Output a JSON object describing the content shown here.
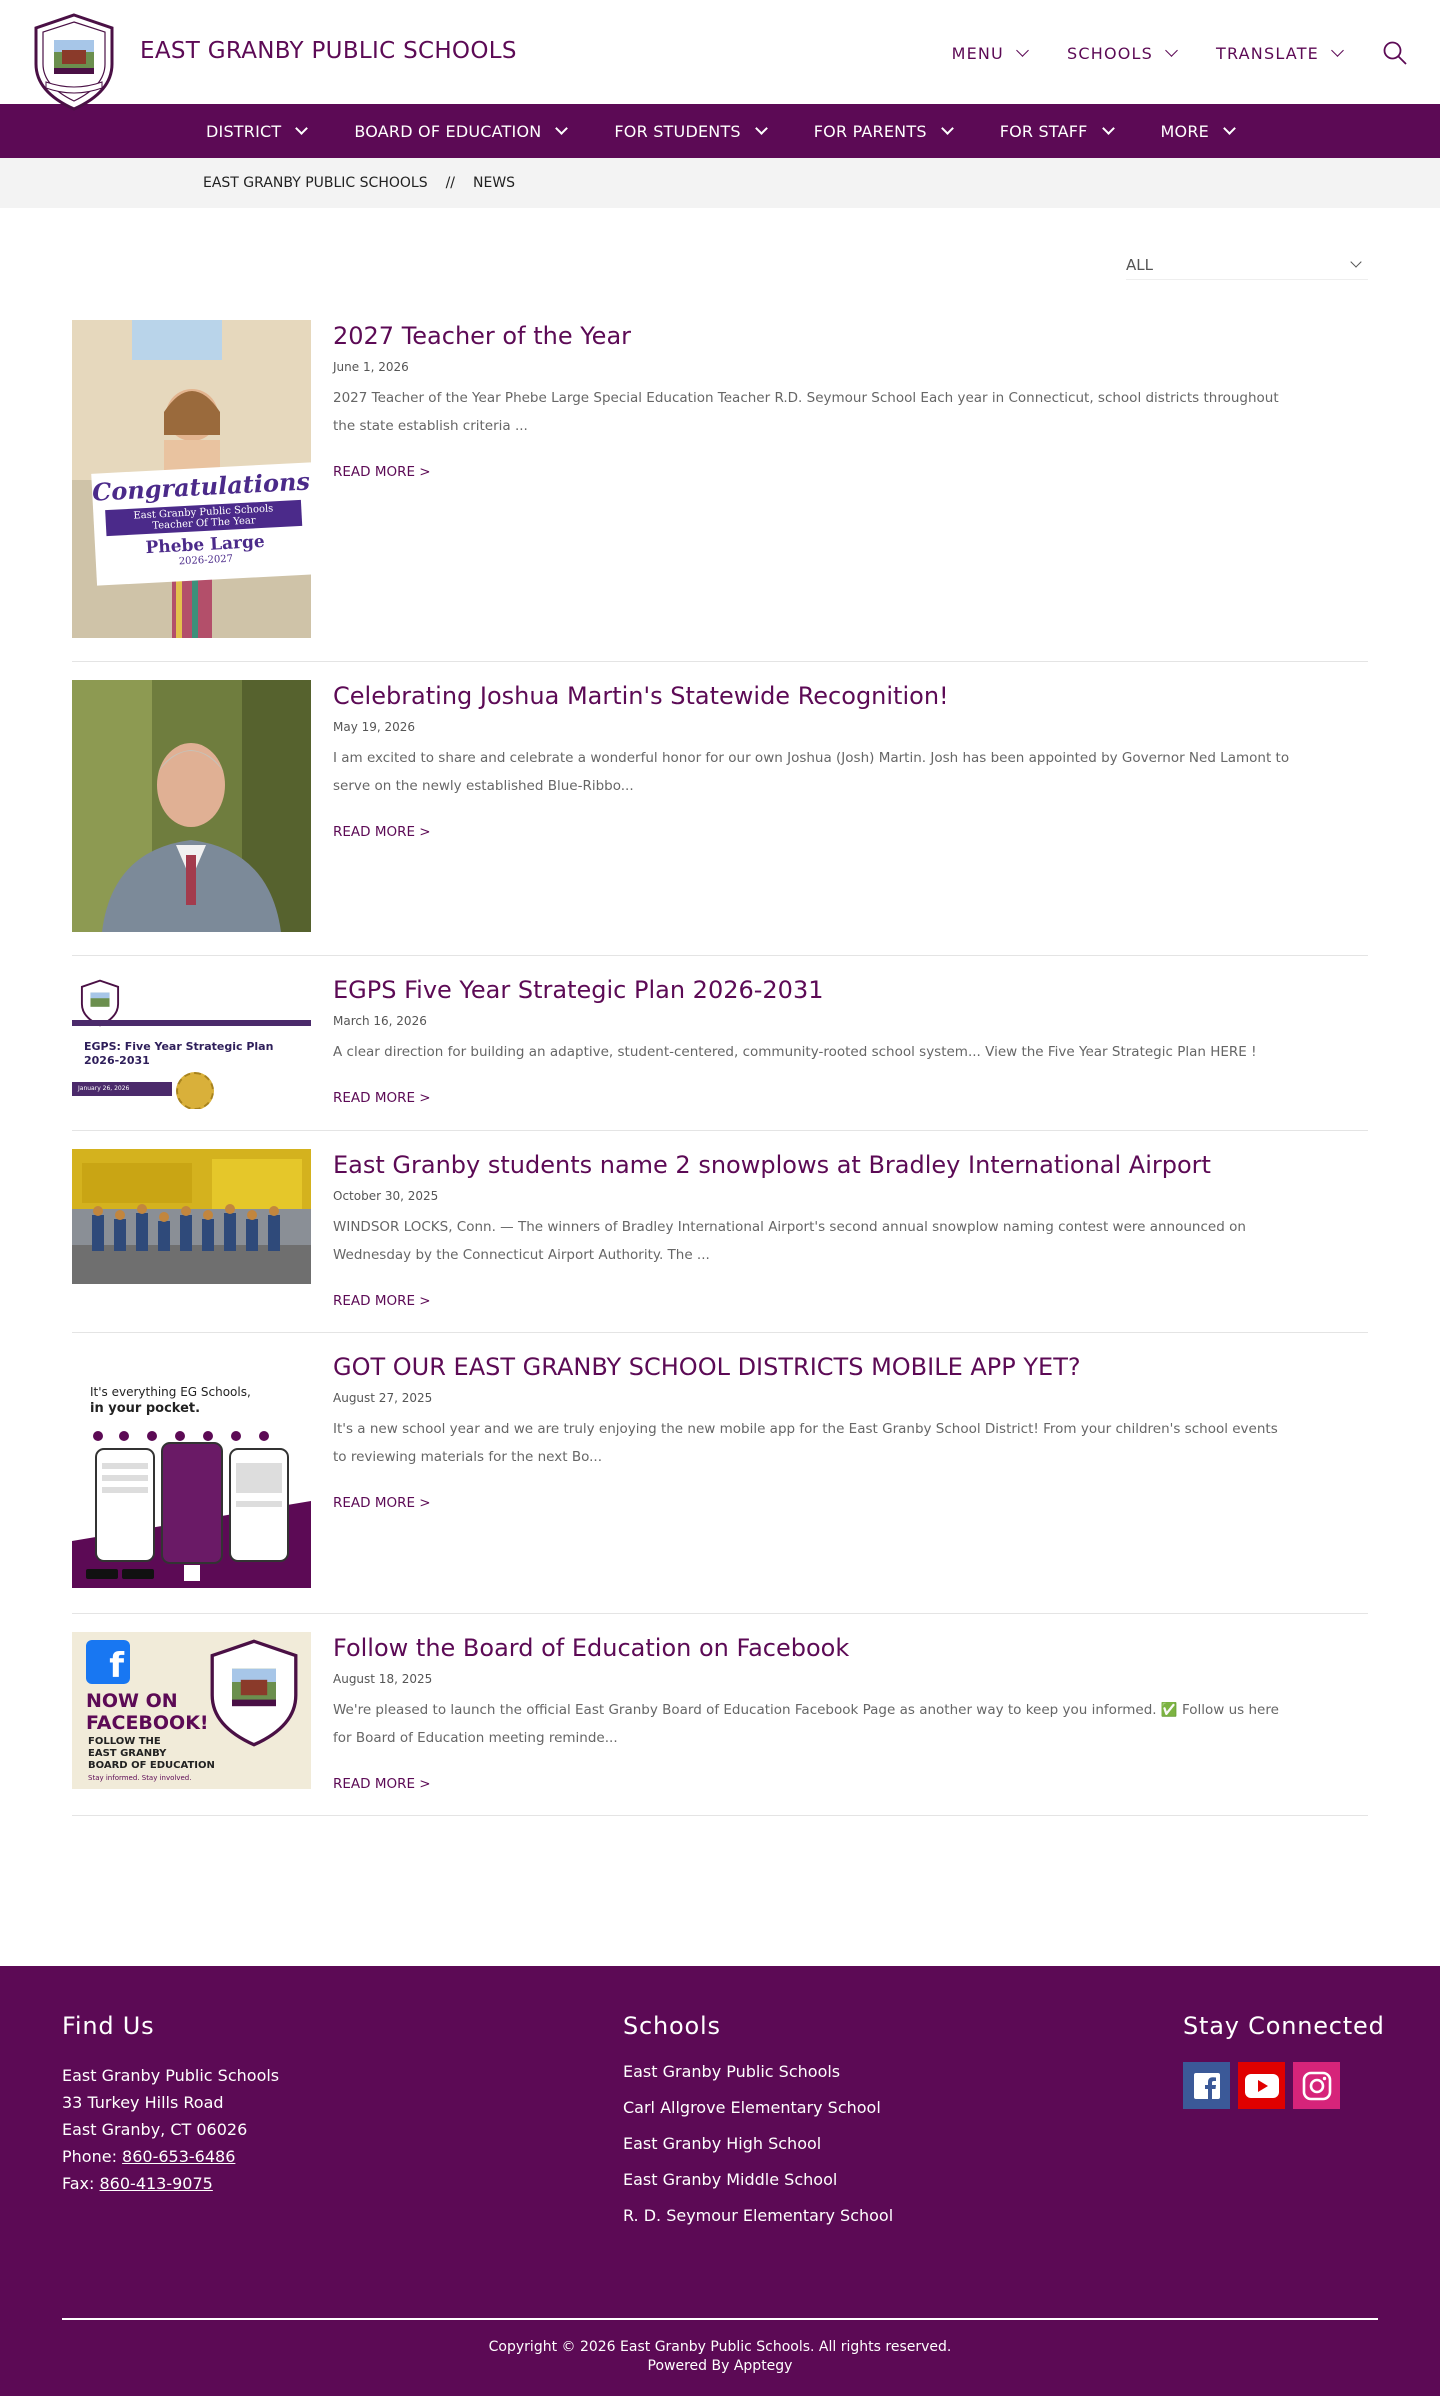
{
  "header": {
    "site_title": "EAST GRANBY PUBLIC SCHOOLS",
    "top_nav": [
      "MENU",
      "SCHOOLS",
      "TRANSLATE"
    ]
  },
  "main_nav": [
    "DISTRICT",
    "BOARD OF EDUCATION",
    "FOR STUDENTS",
    "FOR PARENTS",
    "FOR STAFF",
    "MORE"
  ],
  "breadcrumb": {
    "home": "EAST GRANBY PUBLIC SCHOOLS",
    "separator": "//",
    "current": "NEWS"
  },
  "filter": {
    "selected": "ALL"
  },
  "read_more_label": "READ MORE >",
  "news": [
    {
      "title": "2027 Teacher of the Year",
      "date": "June 1, 2026",
      "excerpt": "2027 Teacher of the Year Phebe Large Special Education Teacher R.D. Seymour School Each year in Connecticut, school districts throughout the state establish criteria ...",
      "banner": {
        "line1": "Congratulations!",
        "line2": "East Granby Public Schools",
        "line3": "Teacher Of The Year",
        "line4": "Phebe Large",
        "line5": "2026-2027"
      }
    },
    {
      "title": "Celebrating Joshua Martin's Statewide Recognition!",
      "date": "May 19, 2026",
      "excerpt": "I am excited to share and celebrate a wonderful honor for our own Joshua (Josh) Martin. Josh has been appointed by Governor Ned Lamont to serve on the newly established Blue-Ribbo..."
    },
    {
      "title": "EGPS Five Year Strategic Plan 2026-2031",
      "date": "March 16, 2026",
      "excerpt": "A clear direction for building an adaptive, student-centered, community-rooted school system... View the Five Year Strategic Plan HERE !",
      "graphic": {
        "line1": "EGPS: Five Year Strategic Plan",
        "line2": "2026-2031",
        "tag": "January 26, 2026"
      }
    },
    {
      "title": "East Granby students name 2 snowplows at Bradley International Airport",
      "date": "October 30, 2025",
      "excerpt": "WINDSOR LOCKS, Conn. — The winners of Bradley International Airport's second annual snowplow naming contest were announced on Wednesday by the Connecticut Airport Authority. The ..."
    },
    {
      "title": "GOT OUR EAST GRANBY SCHOOL DISTRICTS MOBILE APP YET?",
      "date": "August 27, 2025",
      "excerpt": "It's a new school year and we are truly enjoying the new mobile app for the East Granby School District! From your children's school events to reviewing materials for the next Bo...",
      "graphic": {
        "line1": "It's everything EG Schools,",
        "line2": "in your pocket."
      }
    },
    {
      "title": "Follow the Board of Education on Facebook",
      "date": "August 18, 2025",
      "excerpt": "We're pleased to launch the official East Granby Board of Education Facebook Page as another way to keep you informed. ✅ Follow us here for Board of Education meeting reminde...",
      "graphic": {
        "line1": "NOW ON",
        "line2": "FACEBOOK!",
        "line3": "FOLLOW THE",
        "line4": "EAST GRANBY",
        "line5": "BOARD OF EDUCATION",
        "line6": "Stay informed. Stay involved."
      }
    }
  ],
  "footer": {
    "find_us": {
      "heading": "Find Us",
      "name": "East Granby Public Schools",
      "street": "33 Turkey Hills Road",
      "city": "East Granby, CT 06026",
      "phone_label": "Phone:",
      "phone": "860-653-6486",
      "fax_label": "Fax:",
      "fax": "860-413-9075"
    },
    "schools": {
      "heading": "Schools",
      "items": [
        "East Granby Public Schools",
        "Carl Allgrove Elementary School",
        "East Granby High School",
        "East Granby Middle School",
        "R. D. Seymour Elementary School"
      ]
    },
    "connected": {
      "heading": "Stay Connected"
    },
    "copyright": "Copyright © 2026 East Granby Public Schools. All rights reserved.",
    "powered": "Powered By Apptegy"
  },
  "colors": {
    "brand": "#5c0a55",
    "facebook": "#3b5998",
    "youtube": "#e00000",
    "instagram": "#d6247a"
  }
}
